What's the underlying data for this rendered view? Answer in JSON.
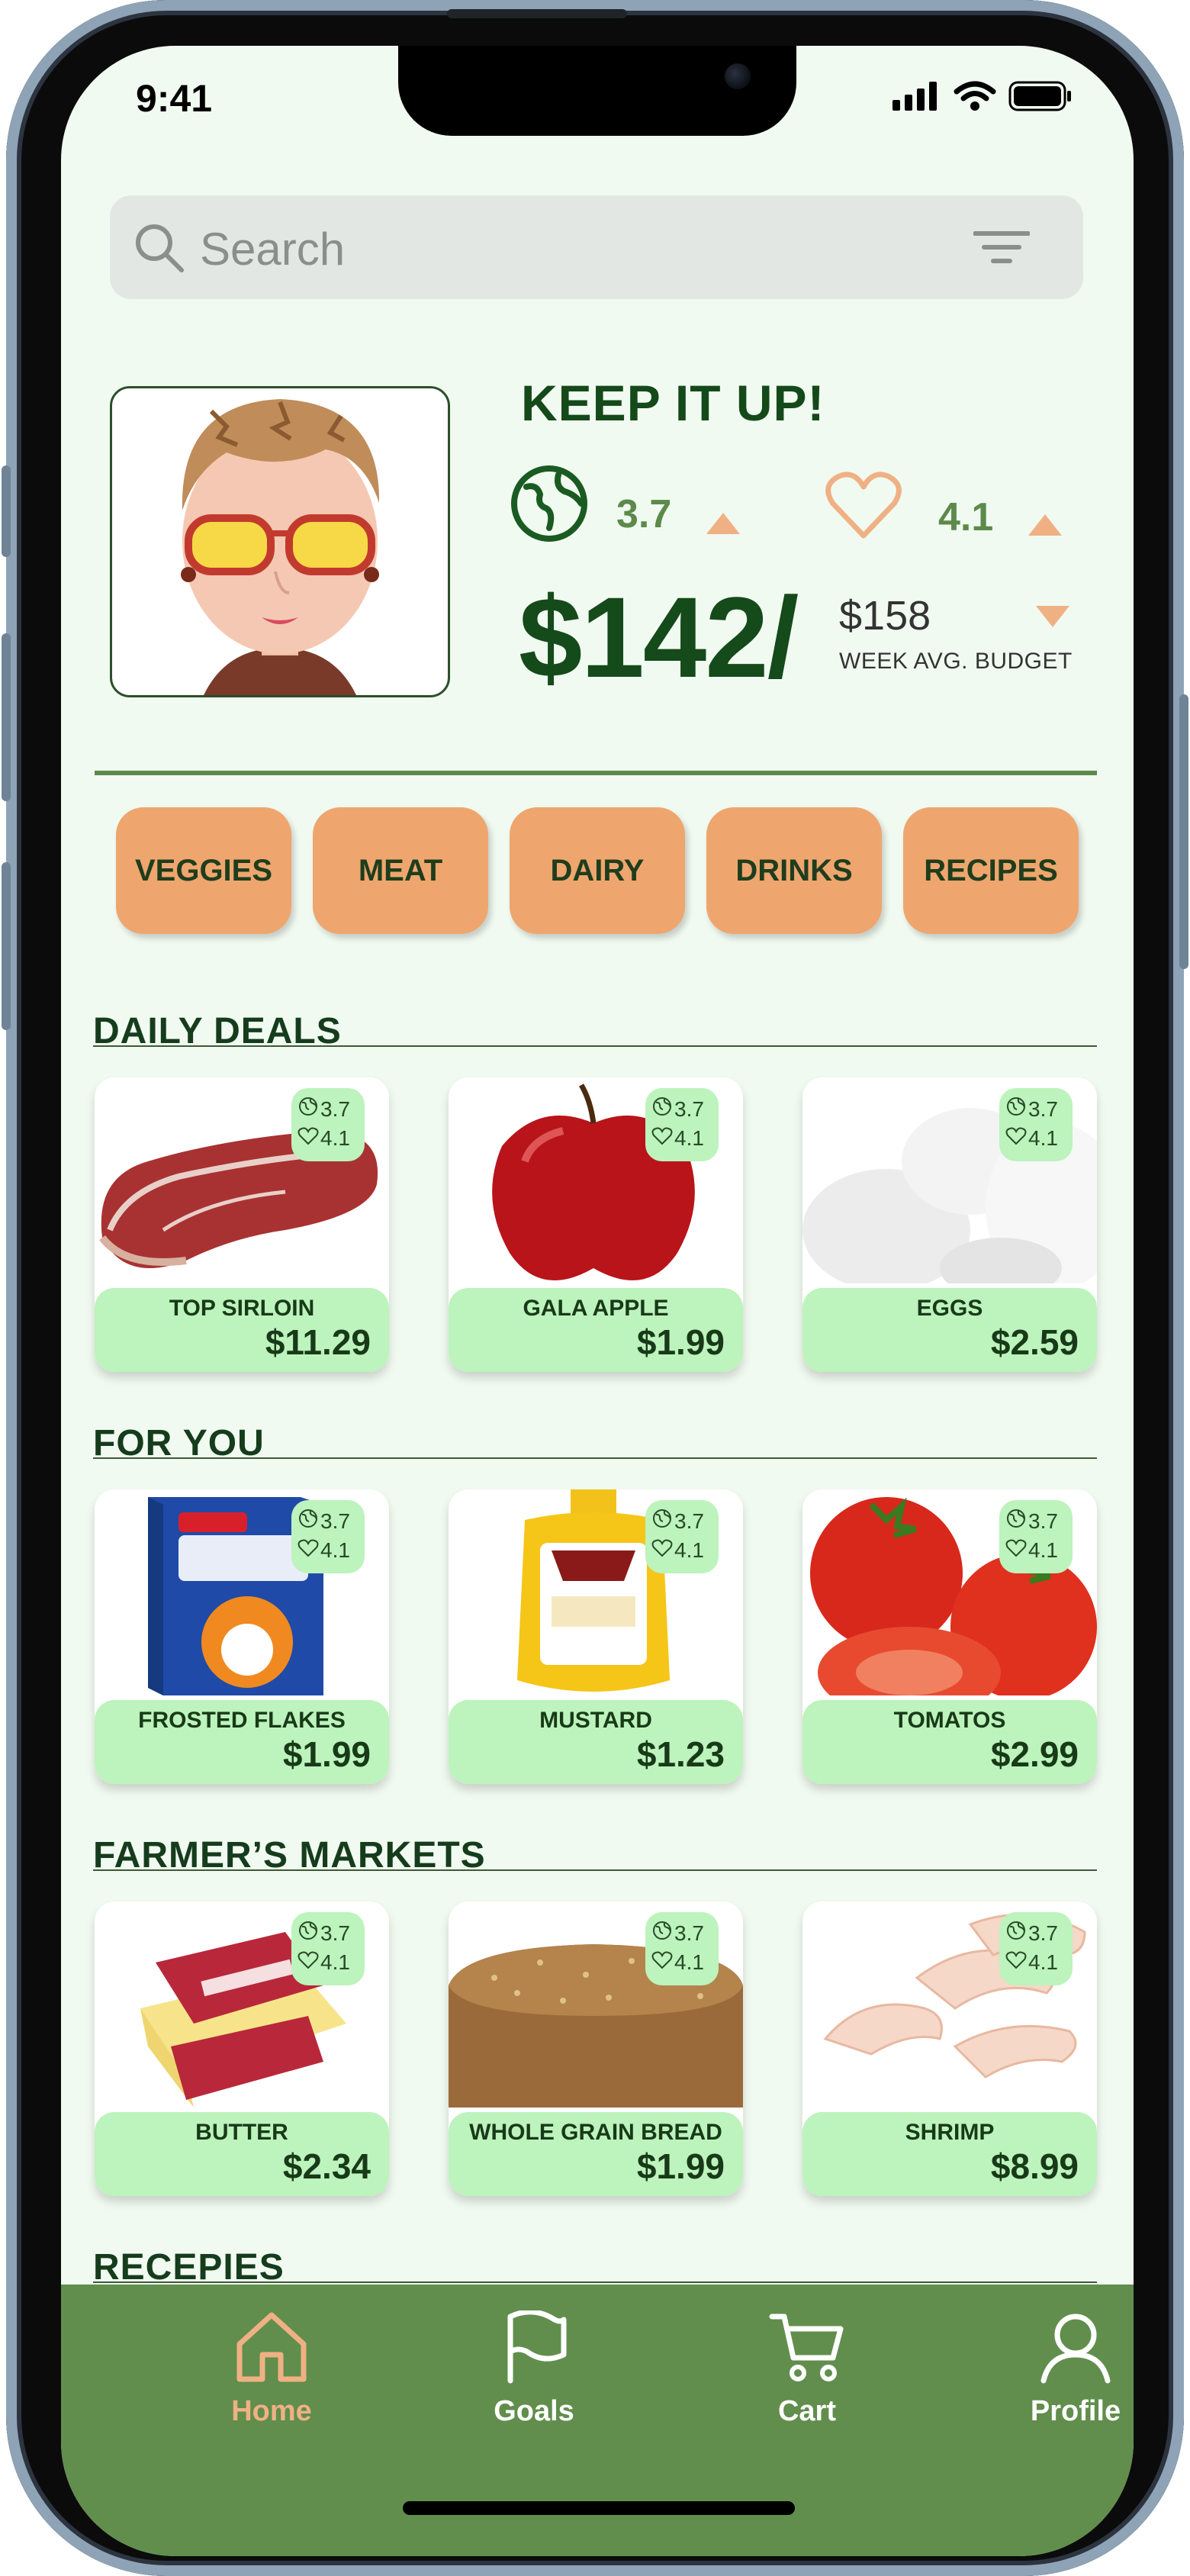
{
  "status": {
    "time": "9:41"
  },
  "search": {
    "placeholder": "Search"
  },
  "summary": {
    "headline": "KEEP IT UP!",
    "eco_score": "3.7",
    "health_score": "4.1",
    "spent": "$142/",
    "budget": "$158",
    "budget_label": "WEEK AVG. BUDGET"
  },
  "categories": [
    "VEGGIES",
    "MEAT",
    "DAIRY",
    "DRINKS",
    "RECIPES"
  ],
  "sections": [
    {
      "title": "DAILY DEALS",
      "items": [
        {
          "name": "TOP SIRLOIN",
          "price": "$11.29",
          "eco": "3.7",
          "health": "4.1"
        },
        {
          "name": "GALA APPLE",
          "price": "$1.99",
          "eco": "3.7",
          "health": "4.1"
        },
        {
          "name": "EGGS",
          "price": "$2.59",
          "eco": "3.7",
          "health": "4.1"
        }
      ]
    },
    {
      "title": "FOR YOU",
      "items": [
        {
          "name": "FROSTED FLAKES",
          "price": "$1.99",
          "eco": "3.7",
          "health": "4.1"
        },
        {
          "name": "MUSTARD",
          "price": "$1.23",
          "eco": "3.7",
          "health": "4.1"
        },
        {
          "name": "TOMATOS",
          "price": "$2.99",
          "eco": "3.7",
          "health": "4.1"
        }
      ]
    },
    {
      "title": "FARMER’S MARKETS",
      "items": [
        {
          "name": "BUTTER",
          "price": "$2.34",
          "eco": "3.7",
          "health": "4.1"
        },
        {
          "name": "WHOLE GRAIN BREAD",
          "price": "$1.99",
          "eco": "3.7",
          "health": "4.1"
        },
        {
          "name": "SHRIMP",
          "price": "$8.99",
          "eco": "3.7",
          "health": "4.1"
        }
      ]
    },
    {
      "title": "RECEPIES",
      "items": []
    }
  ],
  "tabs": {
    "home": "Home",
    "goals": "Goals",
    "cart": "Cart",
    "profile": "Profile"
  },
  "colors": {
    "accent": "#eea66e",
    "brand_green": "#618e4c",
    "tag_green": "#bdf3bd",
    "text_dark_green": "#14491a"
  },
  "icons": [
    "search-icon",
    "filter-icon",
    "globe-icon",
    "heart-icon",
    "home-icon",
    "flag-icon",
    "cart-icon",
    "profile-icon"
  ]
}
